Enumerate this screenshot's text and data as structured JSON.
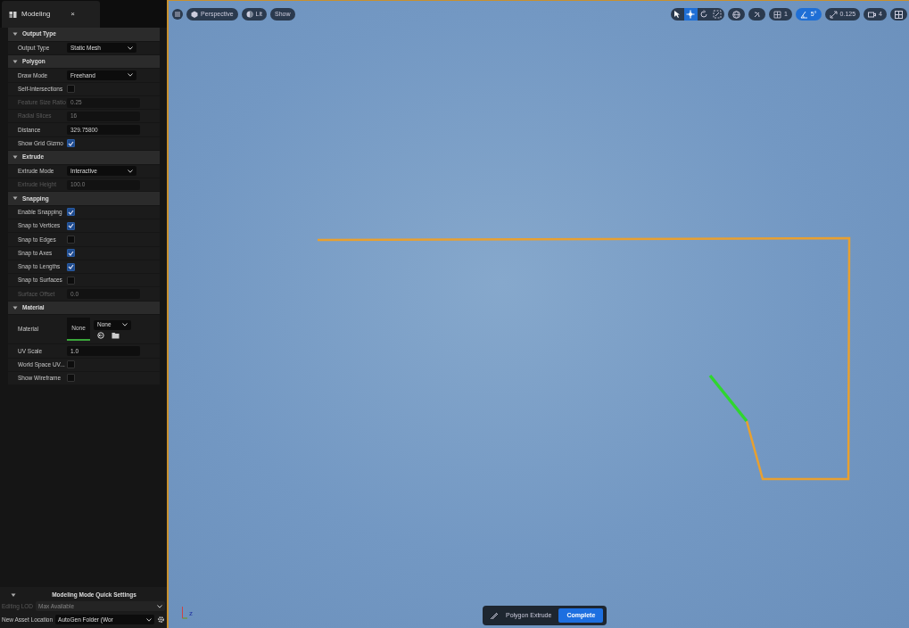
{
  "panel": {
    "tab": {
      "title": "Modeling",
      "close": "×"
    },
    "sections": [
      {
        "title": "Output Type",
        "expanded": true,
        "rows": [
          {
            "kind": "dropdown",
            "label": "Output Type",
            "value": "Static Mesh",
            "disabled": false
          }
        ]
      },
      {
        "title": "Polygon",
        "expanded": true,
        "rows": [
          {
            "kind": "dropdown",
            "label": "Draw Mode",
            "value": "Freehand",
            "disabled": false
          },
          {
            "kind": "checkbox",
            "label": "Self-Intersections",
            "checked": false,
            "disabled": false
          },
          {
            "kind": "number",
            "label": "Feature Size Ratio",
            "value": "0.25",
            "disabled": true
          },
          {
            "kind": "number",
            "label": "Radial Slices",
            "value": "16",
            "disabled": true
          },
          {
            "kind": "number",
            "label": "Distance",
            "value": "329.75800",
            "disabled": false
          },
          {
            "kind": "checkbox",
            "label": "Show Grid Gizmo",
            "checked": true,
            "disabled": false
          }
        ]
      },
      {
        "title": "Extrude",
        "expanded": true,
        "rows": [
          {
            "kind": "dropdown",
            "label": "Extrude Mode",
            "value": "Interactive",
            "disabled": false
          },
          {
            "kind": "number",
            "label": "Extrude Height",
            "value": "100.0",
            "disabled": true
          }
        ]
      },
      {
        "title": "Snapping",
        "expanded": true,
        "rows": [
          {
            "kind": "checkbox",
            "label": "Enable Snapping",
            "checked": true,
            "disabled": false
          },
          {
            "kind": "checkbox",
            "label": "Snap to Vertices",
            "checked": true,
            "disabled": false
          },
          {
            "kind": "checkbox",
            "label": "Snap to Edges",
            "checked": false,
            "disabled": false
          },
          {
            "kind": "checkbox",
            "label": "Snap to Axes",
            "checked": true,
            "disabled": false
          },
          {
            "kind": "checkbox",
            "label": "Snap to Lengths",
            "checked": true,
            "disabled": false
          },
          {
            "kind": "checkbox",
            "label": "Snap to Surfaces",
            "checked": false,
            "disabled": false
          },
          {
            "kind": "number",
            "label": "Surface Offset",
            "value": "0.0",
            "disabled": true
          }
        ]
      },
      {
        "title": "Material",
        "expanded": true,
        "rows": [
          {
            "kind": "material",
            "label": "Material",
            "thumb": "None",
            "value": "None",
            "disabled": false
          },
          {
            "kind": "number",
            "label": "UV Scale",
            "value": "1.0",
            "disabled": false
          },
          {
            "kind": "checkbox",
            "label": "World Space UV...",
            "checked": false,
            "disabled": false
          },
          {
            "kind": "checkbox",
            "label": "Show Wireframe",
            "checked": false,
            "disabled": false
          }
        ]
      }
    ],
    "quick_settings": {
      "title": "Modeling Mode Quick Settings",
      "expanded": true,
      "rows": [
        {
          "label": "Editing LOD",
          "value": "Max Available",
          "disabled": true
        },
        {
          "label": "New Asset Location",
          "value": "AutoGen Folder (Wor",
          "disabled": false
        }
      ]
    }
  },
  "viewport": {
    "left_toolbar": [
      {
        "kind": "menu"
      },
      {
        "kind": "view",
        "label": "Perspective"
      },
      {
        "kind": "lit",
        "label": "Lit"
      },
      {
        "kind": "plain",
        "label": "Show"
      }
    ],
    "transform_tools": [
      {
        "kind": "select",
        "selected": false
      },
      {
        "kind": "move",
        "selected": true
      },
      {
        "kind": "rotate",
        "selected": false
      },
      {
        "kind": "scale",
        "selected": false
      }
    ],
    "right_toolbar": [
      {
        "kind": "globe",
        "on": false
      },
      {
        "kind": "surface",
        "on": false
      },
      {
        "kind": "grid",
        "label": "1",
        "on": false
      },
      {
        "kind": "angle",
        "label": "5°",
        "on": true
      },
      {
        "kind": "scale",
        "label": "0.125",
        "on": false
      },
      {
        "kind": "camera",
        "label": "4",
        "on": false
      },
      {
        "kind": "layout",
        "on": false
      }
    ],
    "axis_label": "z",
    "tool_bar": {
      "title": "Polygon Extrude",
      "button": "Complete"
    }
  }
}
